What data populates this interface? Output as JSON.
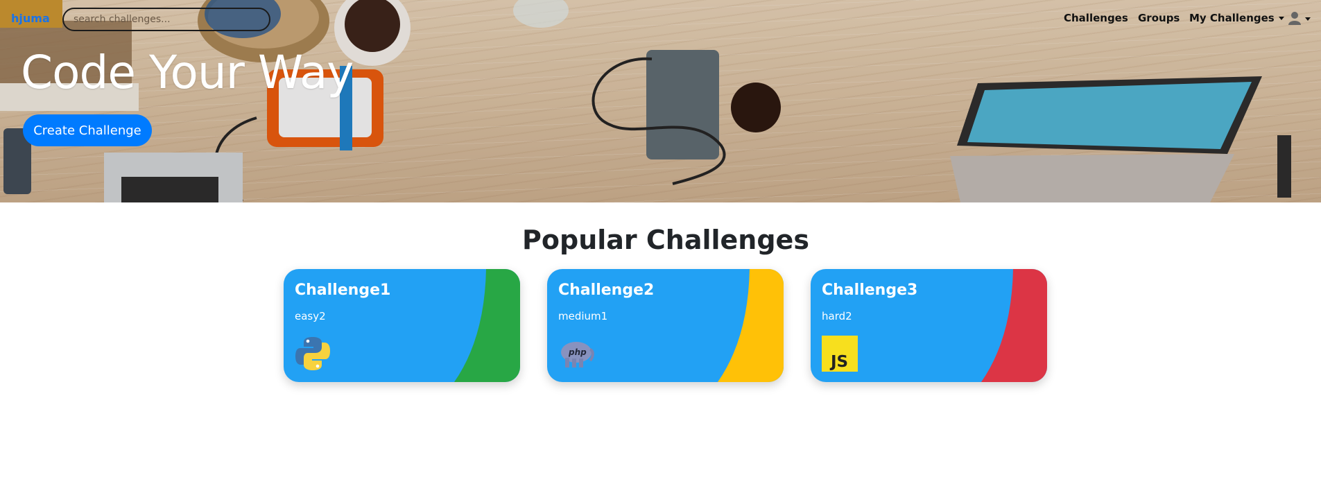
{
  "navbar": {
    "brand": "hjuma",
    "search_placeholder": "search challenges...",
    "links": [
      "Challenges",
      "Groups",
      "My Challenges"
    ]
  },
  "hero": {
    "title": "Code Your Way",
    "button": "Create Challenge"
  },
  "section_title": "Popular Challenges",
  "cards": [
    {
      "title": "Challenge1",
      "difficulty": "easy2",
      "accent": "#28a745",
      "icon": "python-icon"
    },
    {
      "title": "Challenge2",
      "difficulty": "medium1",
      "accent": "#ffc107",
      "icon": "php-icon"
    },
    {
      "title": "Challenge3",
      "difficulty": "hard2",
      "accent": "#dc3545",
      "icon": "javascript-icon"
    }
  ],
  "colors": {
    "card_bg": "#22a1f4",
    "primary": "#007bff"
  }
}
